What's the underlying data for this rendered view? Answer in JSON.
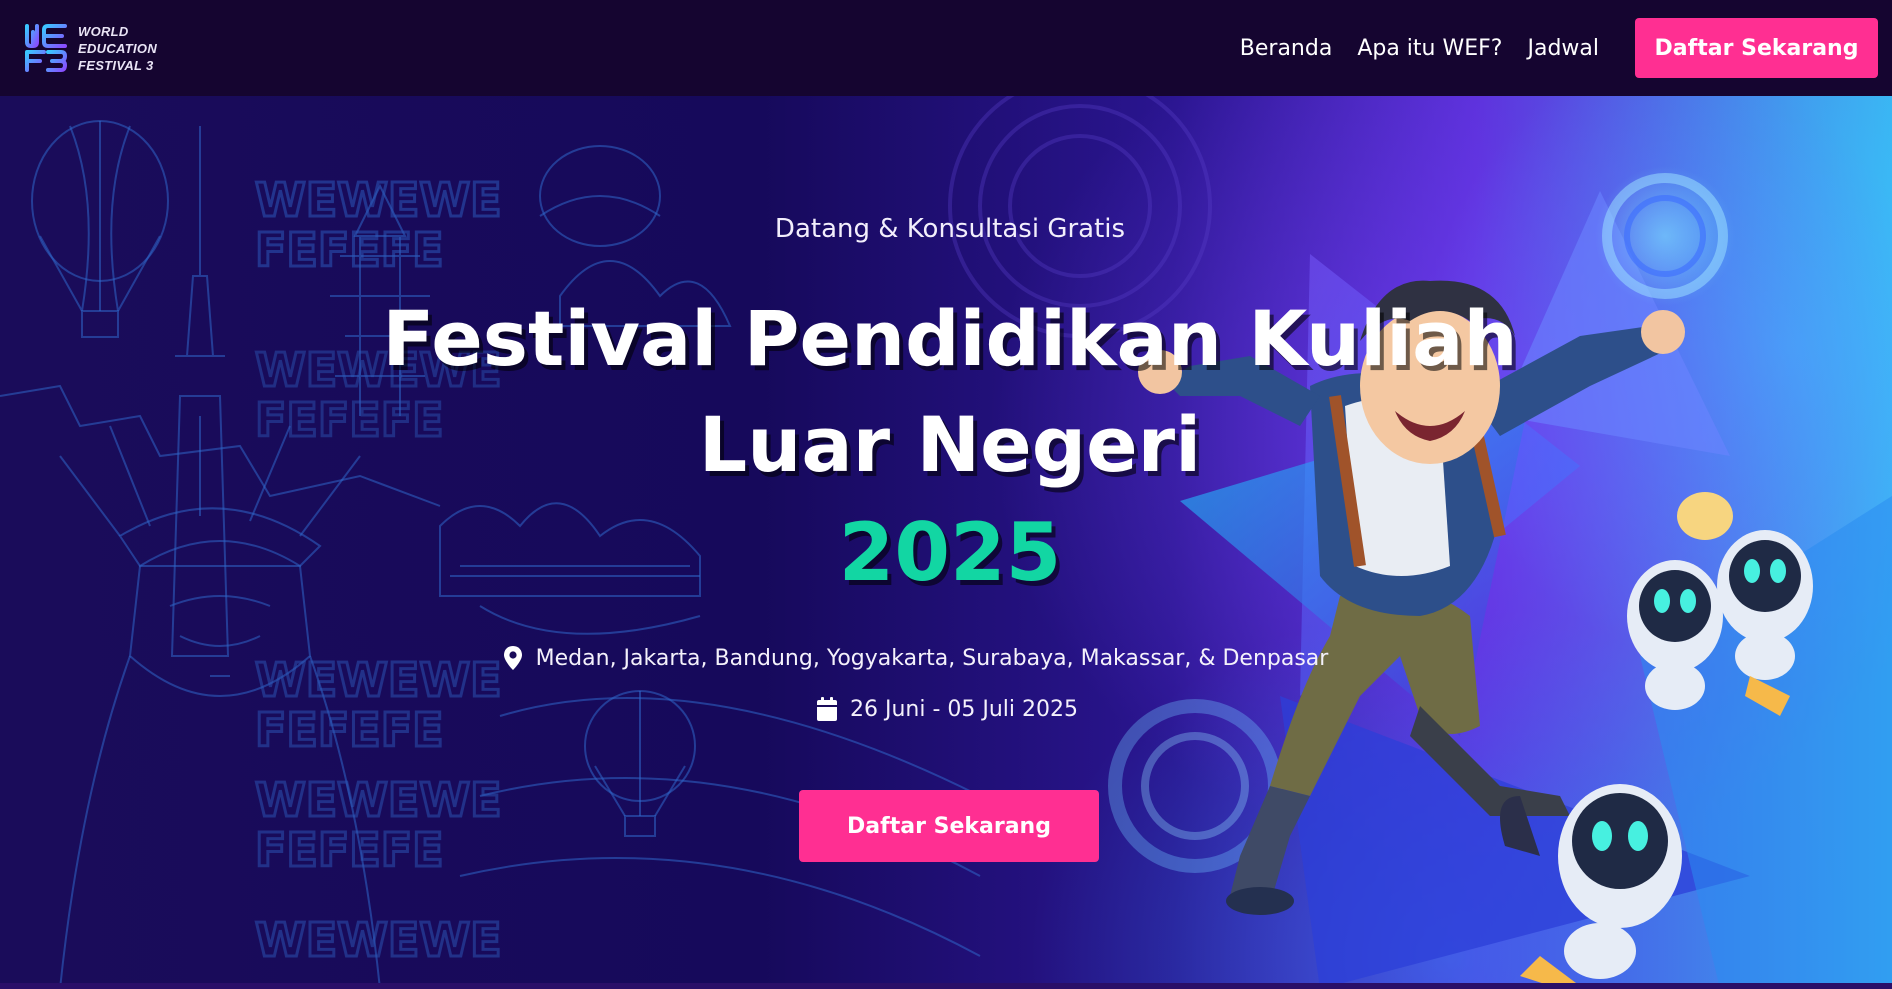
{
  "brand": {
    "logo_text_lines": [
      "WORLD",
      "EDUCATION",
      "FESTIVAL 3"
    ],
    "colors": {
      "pink": "#ff2f92",
      "teal": "#12d6a3",
      "navy": "#150530"
    }
  },
  "nav": {
    "links": [
      "Beranda",
      "Apa itu WEF?",
      "Jadwal"
    ],
    "cta_label": "Daftar Sekarang"
  },
  "hero": {
    "pre_title": "Datang & Konsultasi Gratis",
    "title_line1": "Festival Pendidikan Kuliah",
    "title_line2": "Luar Negeri",
    "year": "2025",
    "locations": "Medan, Jakarta, Bandung, Yogyakarta, Surabaya, Makassar, & Denpasar",
    "dates": "26 Juni - 05 Juli 2025",
    "cta_label": "Daftar Sekarang",
    "icons": {
      "location": "map-pin-icon",
      "date": "calendar-icon"
    }
  }
}
